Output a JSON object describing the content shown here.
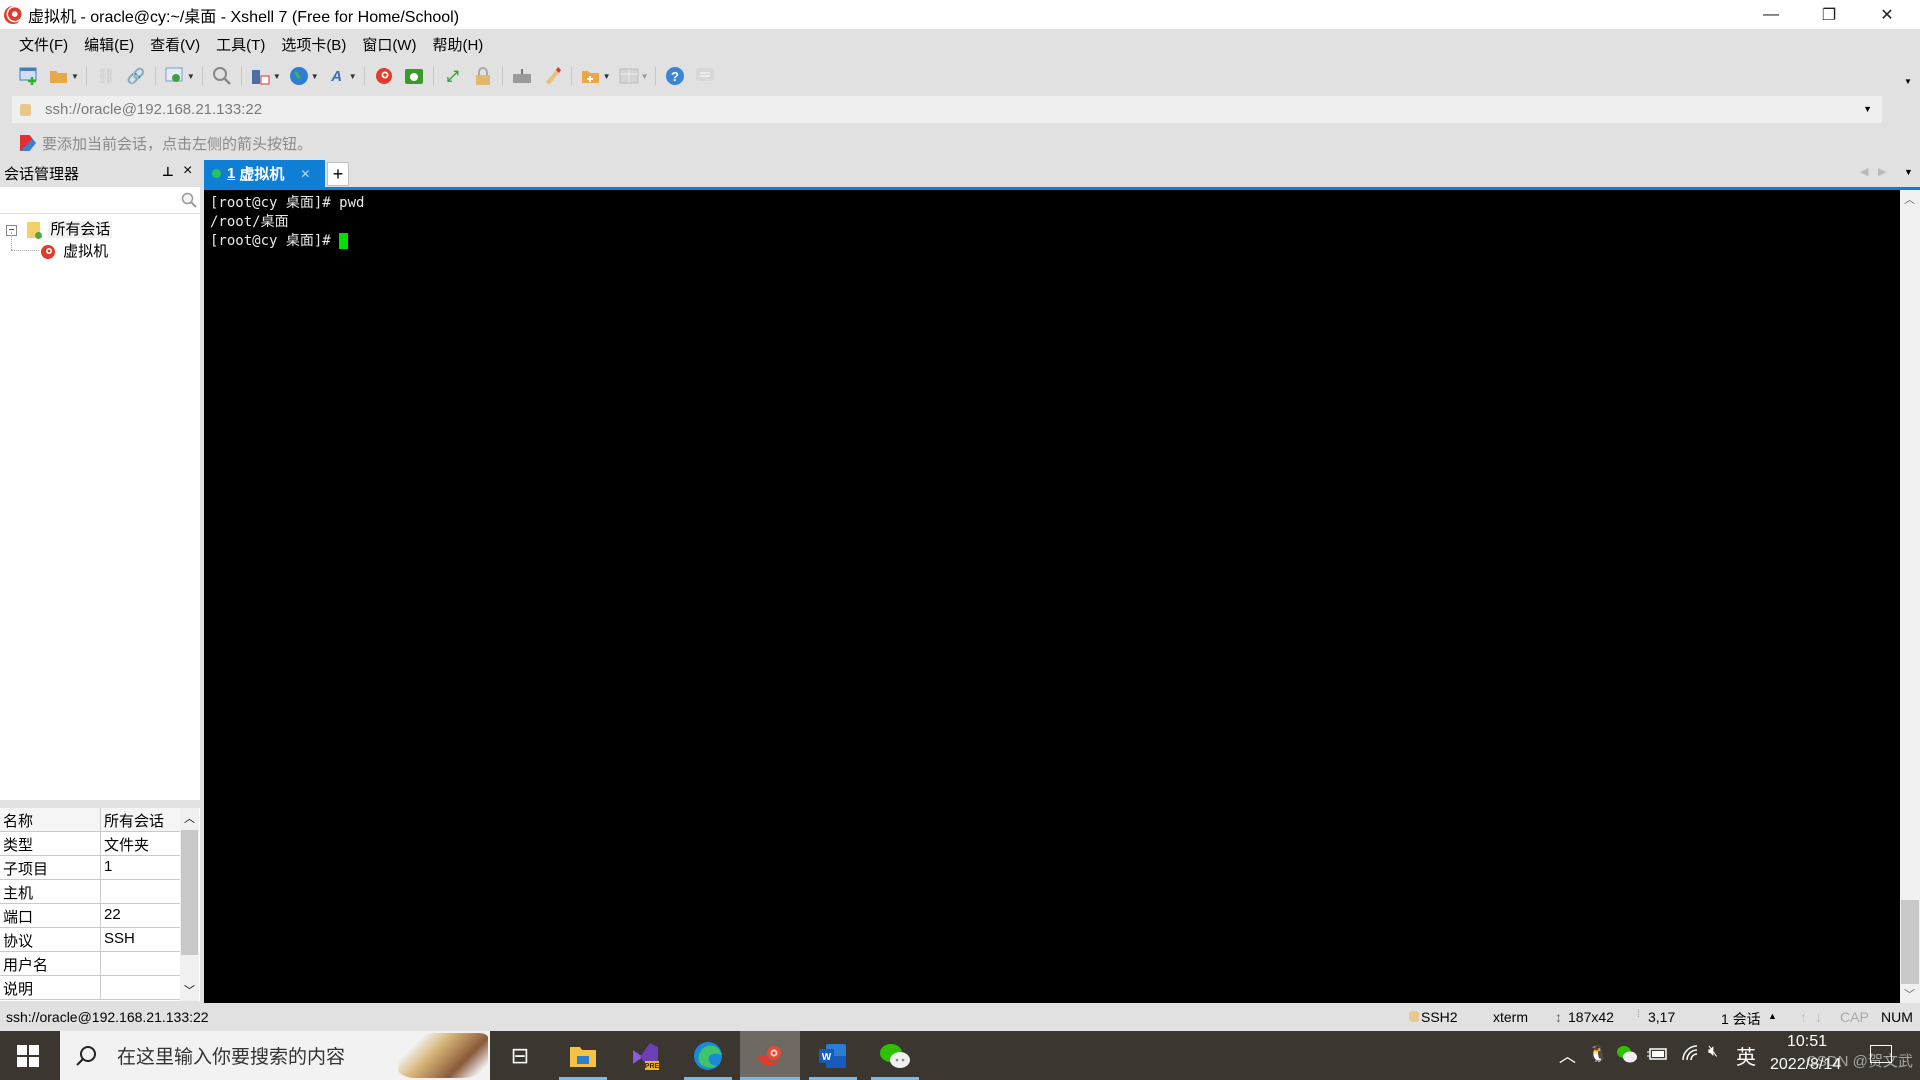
{
  "window": {
    "title": "虚拟机 - oracle@cy:~/桌面 - Xshell 7 (Free for Home/School)",
    "minimize": "—",
    "restore": "❐",
    "close": "✕"
  },
  "menu": [
    "文件(F)",
    "编辑(E)",
    "查看(V)",
    "工具(T)",
    "选项卡(B)",
    "窗口(W)",
    "帮助(H)"
  ],
  "toolbar": {
    "icons": [
      "new-session-icon",
      "open-folder-icon",
      "disconnect-icon",
      "reconnect-icon",
      "session-properties-icon",
      "find-icon",
      "transfer-icon",
      "globe-icon",
      "font-icon",
      "xshell-icon",
      "xftp-icon",
      "fullscreen-icon",
      "lock-icon",
      "keyboard-icon",
      "highlight-icon",
      "new-folder-icon",
      "layout-icon",
      "help-icon",
      "chat-icon"
    ]
  },
  "address": {
    "value": "ssh://oracle@192.168.21.133:22"
  },
  "hint": {
    "text": "要添加当前会话，点击左侧的箭头按钮。"
  },
  "session_manager": {
    "title": "会话管理器",
    "pin": "📌",
    "close": "×",
    "search_placeholder": "",
    "tree": {
      "root": "所有会话",
      "children": [
        "虚拟机"
      ]
    },
    "properties": [
      {
        "key": "名称",
        "value": "所有会话"
      },
      {
        "key": "类型",
        "value": "文件夹"
      },
      {
        "key": "子项目",
        "value": "1"
      },
      {
        "key": "主机",
        "value": ""
      },
      {
        "key": "端口",
        "value": "22"
      },
      {
        "key": "协议",
        "value": "SSH"
      },
      {
        "key": "用户名",
        "value": ""
      },
      {
        "key": "说明",
        "value": ""
      }
    ]
  },
  "tabs": [
    {
      "number": "1",
      "label": "虚拟机",
      "active": true,
      "status_color": "#22c55e"
    }
  ],
  "terminal": {
    "lines": [
      "[root@cy 桌面]# pwd",
      "/root/桌面",
      "[root@cy 桌面]# "
    ],
    "cursor_color": "#00e000"
  },
  "statusbar": {
    "left": "ssh://oracle@192.168.21.133:22",
    "protocol": "SSH2",
    "term_type": "xterm",
    "size": "187x42",
    "cursor_pos": "3,17",
    "sessions": "1 会话",
    "cap": "CAP",
    "num": "NUM"
  },
  "taskbar": {
    "search_placeholder": "在这里输入你要搜索的内容",
    "apps": [
      "task-view",
      "file-explorer",
      "visual-studio-preview",
      "edge",
      "xshell",
      "word",
      "wechat"
    ],
    "tray": {
      "ime": "英",
      "time": "10:51",
      "date": "2022/8/14"
    },
    "watermark": "CSDN @贺文武"
  }
}
